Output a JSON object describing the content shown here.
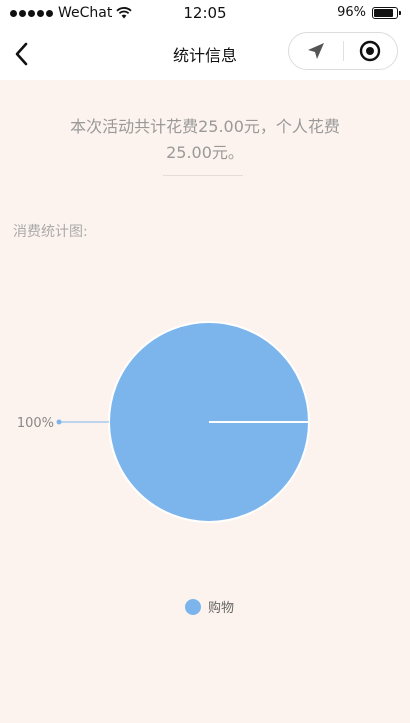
{
  "status_bar": {
    "carrier": "WeChat",
    "time": "12:05",
    "battery_percent_text": "96%",
    "battery_level": 0.96,
    "icons": [
      "signal-dots-icon",
      "wifi-icon",
      "battery-icon"
    ]
  },
  "nav": {
    "title": "统计信息",
    "icons": [
      "back-chevron-icon",
      "location-arrow-icon",
      "target-circle-icon"
    ]
  },
  "summary": {
    "line1": "本次活动共计花费25.00元，个人花费",
    "line2": "25.00元。"
  },
  "chart_heading": "消费统计图:",
  "colors": {
    "page_background": "#fdf3ee",
    "slice": "#7cb5ec",
    "muted_text": "#999999"
  },
  "chart_data": {
    "type": "pie",
    "title": "",
    "categories": [
      "购物"
    ],
    "values": [
      25.0
    ],
    "data_labels": [
      "100%"
    ],
    "legend": [
      "购物"
    ],
    "legend_placement": "bottom",
    "colors": [
      "#7cb5ec"
    ]
  }
}
